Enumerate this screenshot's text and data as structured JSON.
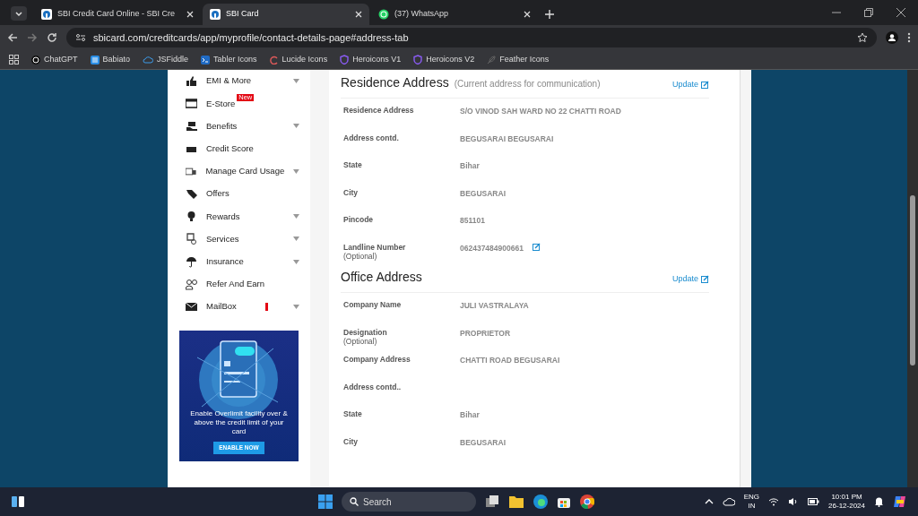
{
  "browser": {
    "tabs": [
      {
        "title": "SBI Credit Card Online - SBI Cre",
        "selected": false
      },
      {
        "title": "SBI Card",
        "selected": true
      },
      {
        "title": "(37) WhatsApp",
        "selected": false
      }
    ],
    "address": "sbicard.com/creditcards/app/myprofile/contact-details-page#address-tab",
    "bookmarks": [
      "ChatGPT",
      "Babiato",
      "JSFiddle",
      "Tabler Icons",
      "Lucide Icons",
      "Heroicons V1",
      "Heroicons V2",
      "Feather Icons"
    ]
  },
  "sidebar": {
    "items": [
      {
        "label": "EMI & More",
        "expandable": true
      },
      {
        "label": "E-Store",
        "expandable": false,
        "badge": "New"
      },
      {
        "label": "Benefits",
        "expandable": true
      },
      {
        "label": "Credit Score",
        "expandable": false
      },
      {
        "label": "Manage Card Usage",
        "expandable": true
      },
      {
        "label": "Offers",
        "expandable": false
      },
      {
        "label": "Rewards",
        "expandable": true
      },
      {
        "label": "Services",
        "expandable": true
      },
      {
        "label": "Insurance",
        "expandable": true
      },
      {
        "label": "Refer And Earn",
        "expandable": false
      },
      {
        "label": "MailBox",
        "expandable": true,
        "alert": true
      }
    ],
    "promo": {
      "text": "Enable Overlimit facility over & above the credit limit of your card",
      "button": "ENABLE NOW"
    }
  },
  "sections": [
    {
      "title": "Residence Address",
      "subtitle": "(Current address for communication)",
      "action": "Update",
      "rows": [
        {
          "label": "Residence Address",
          "value": "S/O VINOD SAH WARD NO 22 CHATTI ROAD"
        },
        {
          "label": "Address contd.",
          "value": "BEGUSARAI BEGUSARAI"
        },
        {
          "label": "State",
          "value": "Bihar"
        },
        {
          "label": "City",
          "value": "BEGUSARAI"
        },
        {
          "label": "Pincode",
          "value": "851101"
        },
        {
          "label": "Landline Number",
          "note": "(Optional)",
          "value": "062437484900661",
          "editable": true
        }
      ]
    },
    {
      "title": "Office Address",
      "action": "Update",
      "rows": [
        {
          "label": "Company Name",
          "value": "JULI VASTRALAYA"
        },
        {
          "label": "Designation",
          "note": "(Optional)",
          "value": "PROPRIETOR"
        },
        {
          "label": "Company Address",
          "value": "CHATTI ROAD BEGUSARAI"
        },
        {
          "label": "Address contd.."
        },
        {
          "label": "State",
          "value": "Bihar"
        },
        {
          "label": "City",
          "value": "BEGUSARAI"
        }
      ]
    }
  ],
  "taskbar": {
    "search": {
      "placeholder": "Search"
    },
    "language": "ENG",
    "region": "IN",
    "time": "10:01 PM",
    "date": "26-12-2024"
  }
}
